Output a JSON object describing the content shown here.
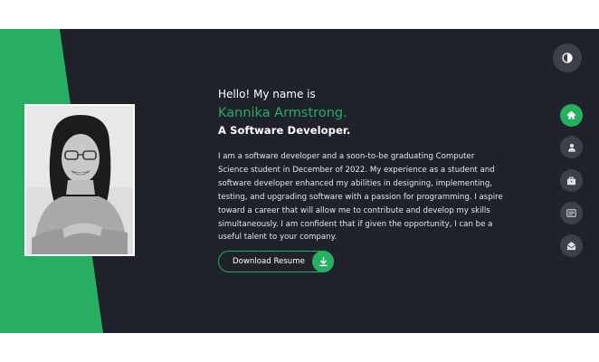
{
  "hero": {
    "greeting": "Hello! My name is",
    "name": "Kannika Armstrong.",
    "role": "A Software Developer.",
    "bio": "I am a software developer and a soon-to-be graduating Computer Science student in December of 2022. My experience as a student and software developer enhanced my abilities in designing, implementing, testing, and upgrading software with a passion for programming. I aspire toward a career that will allow me to contribute and develop my skills simultaneously. I am confident that if given the opportunity, I can be a useful talent to your company.",
    "resume_button_label": "Download Resume",
    "resume_icon": "download-icon"
  },
  "theme_toggle": {
    "icon": "contrast-icon"
  },
  "nav": {
    "items": [
      {
        "icon": "home-icon",
        "active": true
      },
      {
        "icon": "user-icon",
        "active": false
      },
      {
        "icon": "briefcase-icon",
        "active": false
      },
      {
        "icon": "id-card-icon",
        "active": false
      },
      {
        "icon": "envelope-open-icon",
        "active": false
      }
    ]
  },
  "colors": {
    "accent": "#27ae60",
    "background": "#1f222b",
    "nav_button": "#3c4049",
    "text": "#ffffff"
  }
}
